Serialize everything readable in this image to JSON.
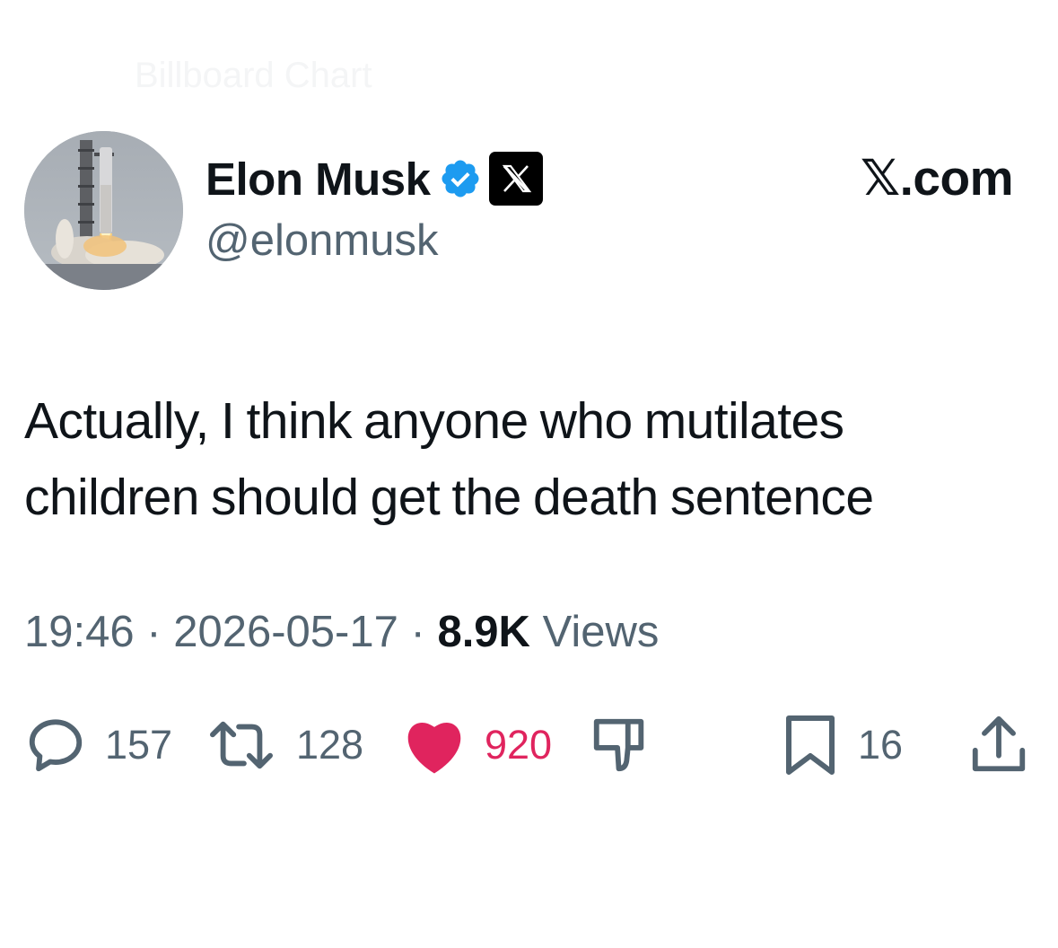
{
  "header": {
    "faded_context": "Billboard Chart",
    "display_name": "Elon Musk",
    "handle": "@elonmusk",
    "site_label": "𝕏.com",
    "verified_icon": "verified-badge-icon",
    "affiliate_icon": "x-logo-icon",
    "verified_color": "#1d9bf0"
  },
  "tweet": {
    "text": "Actually, I think anyone who mutilates children should get the death sentence"
  },
  "meta": {
    "time": "19:46",
    "separator": "·",
    "date": "2026-05-17",
    "views_count": "8.9K",
    "views_label": "Views"
  },
  "actions": {
    "reply_count": "157",
    "repost_count": "128",
    "like_count": "920",
    "bookmark_count": "16",
    "like_color": "#e0245e",
    "icon_color": "#536471"
  },
  "footer": {
    "faded_left": "",
    "faded_right": ""
  }
}
